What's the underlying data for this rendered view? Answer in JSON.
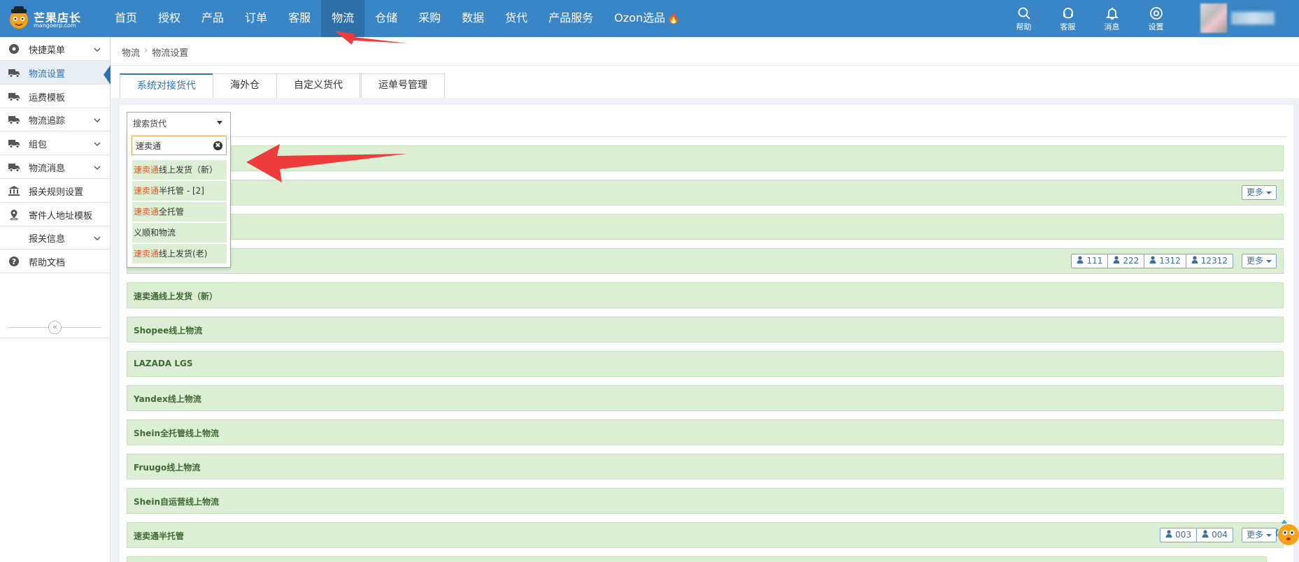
{
  "brand": {
    "name": "芒果店长",
    "site": "mangoerp.com"
  },
  "nav": {
    "items": [
      "首页",
      "授权",
      "产品",
      "订单",
      "客服",
      "物流",
      "仓储",
      "采购",
      "数据",
      "货代",
      "产品服务",
      "Ozon选品"
    ],
    "active": "物流",
    "hot_item": "Ozon选品"
  },
  "top_actions": [
    {
      "label": "帮助",
      "icon": "search-icon"
    },
    {
      "label": "客服",
      "icon": "headset-icon"
    },
    {
      "label": "消息",
      "icon": "bell-icon"
    },
    {
      "label": "设置",
      "icon": "gear-icon"
    }
  ],
  "sidebar": {
    "items": [
      {
        "label": "快捷菜单",
        "icon": "dashboard-icon",
        "expandable": true
      },
      {
        "label": "物流设置",
        "icon": "truck-icon",
        "expandable": false,
        "active": true
      },
      {
        "label": "运费模板",
        "icon": "truck-icon",
        "expandable": false
      },
      {
        "label": "物流追踪",
        "icon": "truck-icon",
        "expandable": true
      },
      {
        "label": "组包",
        "icon": "truck-icon",
        "expandable": true
      },
      {
        "label": "物流消息",
        "icon": "truck-icon",
        "expandable": true
      },
      {
        "label": "报关规则设置",
        "icon": "bank-icon",
        "expandable": false
      },
      {
        "label": "寄件人地址模板",
        "icon": "location-pin-icon",
        "expandable": false
      },
      {
        "label": "报关信息",
        "icon": "",
        "expandable": true
      },
      {
        "label": "帮助文档",
        "icon": "question-icon",
        "expandable": false
      }
    ],
    "collapse_glyph": "«"
  },
  "breadcrumb": {
    "parent": "物流",
    "sep": "›",
    "current": "物流设置"
  },
  "tabs": [
    "系统对接货代",
    "海外仓",
    "自定义货代",
    "运单号管理"
  ],
  "active_tab": "系统对接货代",
  "filter": {
    "select_label": "搜索货代",
    "search_value": "速卖通",
    "clear_glyph": "✖",
    "options": [
      {
        "hl": "速卖通",
        "rest": "线上发货（新）"
      },
      {
        "hl": "速卖通",
        "rest": "半托管 - [2]"
      },
      {
        "hl": "速卖通",
        "rest": "全托管"
      },
      {
        "hl": "",
        "rest": "义顺和物流"
      },
      {
        "hl": "速卖通",
        "rest": "线上发货(老)"
      }
    ]
  },
  "rows": [
    {
      "title": "",
      "accounts": [],
      "more": ""
    },
    {
      "title": "",
      "accounts": [],
      "more": "更多"
    },
    {
      "title": "",
      "accounts": [],
      "more": ""
    },
    {
      "title": "",
      "accounts": [
        "111",
        "222",
        "1312",
        "12312"
      ],
      "more": "更多"
    },
    {
      "title": "速卖通线上发货（新）",
      "accounts": [],
      "more": ""
    },
    {
      "title": "Shopee线上物流",
      "accounts": [],
      "more": ""
    },
    {
      "title": "LAZADA LGS",
      "accounts": [],
      "more": ""
    },
    {
      "title": "Yandex线上物流",
      "accounts": [],
      "more": ""
    },
    {
      "title": "Shein全托管线上物流",
      "accounts": [],
      "more": ""
    },
    {
      "title": "Fruugo线上物流",
      "accounts": [],
      "more": ""
    },
    {
      "title": "Shein自运营线上物流",
      "accounts": [],
      "more": ""
    },
    {
      "title": "速卖通半托管",
      "accounts": [
        "003",
        "004"
      ],
      "more": "更多"
    },
    {
      "title": "",
      "accounts": [],
      "more": ""
    }
  ],
  "colors": {
    "topbar": "#3a85c6",
    "active_nav": "#2e6fa8",
    "row_bg": "#dcefd5",
    "row_text": "#3f6a33",
    "highlight": "#e05a2a",
    "annotation": "#ee3b3b"
  }
}
